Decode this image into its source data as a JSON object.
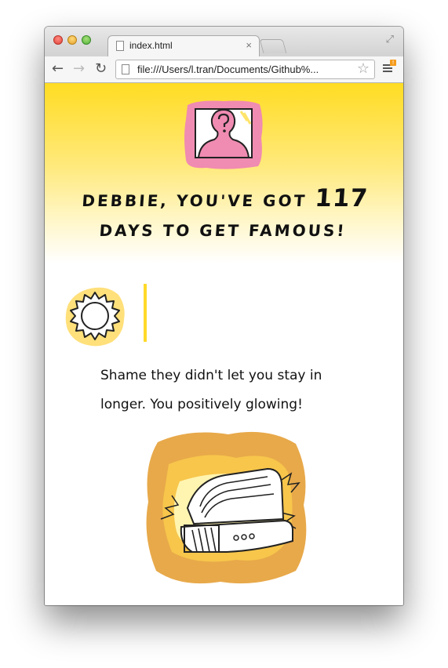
{
  "browser": {
    "tab_title": "index.html",
    "tab_close": "×",
    "url": "file:///Users/l.tran/Documents/Github%...",
    "icons": [
      "back-arrow-icon",
      "forward-arrow-icon",
      "reload-icon",
      "page-icon",
      "bookmark-star-icon",
      "menu-icon",
      "fullscreen-icon"
    ]
  },
  "hero": {
    "headline_prefix": "DEBBIE, YOU'VE GOT",
    "days": "117",
    "headline_suffix": "DAYS TO GET FAMOUS!",
    "background_color": "#ffdc23"
  },
  "section": {
    "icon": "sun-icon",
    "accent_color": "#ffd92a",
    "message": "Shame they didn't let you stay in longer. You positively glowing!",
    "illustration": "tanning-bed-illustration"
  }
}
